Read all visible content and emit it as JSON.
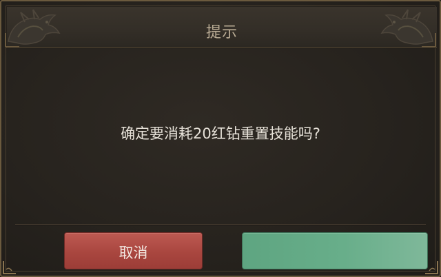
{
  "dialog": {
    "title": "提示",
    "message": "确定要消耗20红钻重置技能吗?",
    "cancel_label": "取消",
    "confirm_label": ""
  },
  "colors": {
    "panel": "#2b2722",
    "header": "#36312a",
    "border_gold": "#6b5a3e",
    "cancel_button": "#a9463f",
    "confirm_button": "#68ae8a",
    "title_text": "#b9ab94",
    "message_text": "#e6e1d8"
  },
  "icons": {
    "left_ornament": "dragon-ornament-icon",
    "right_ornament": "dragon-ornament-icon"
  }
}
